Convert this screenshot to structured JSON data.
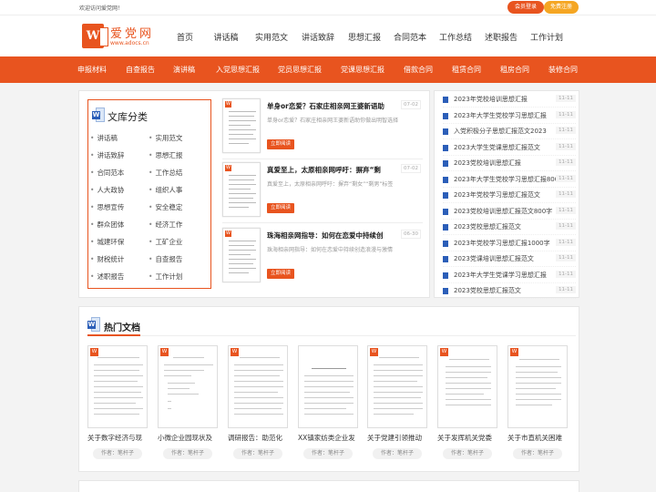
{
  "topbar": {
    "welcome": "欢迎访问爱党网！",
    "login": "会员登录",
    "register": "免费注册"
  },
  "logo": {
    "mark": "W",
    "name": "爱党网",
    "url": "www.adocs.cn"
  },
  "nav": [
    "首页",
    "讲话稿",
    "实用范文",
    "讲话致辞",
    "思想汇报",
    "合同范本",
    "工作总结",
    "述职报告",
    "工作计划"
  ],
  "subnav": [
    "申报材料",
    "自查报告",
    "演讲稿",
    "入党思想汇报",
    "党员思想汇报",
    "党课思想汇报",
    "借款合同",
    "租赁合同",
    "租房合同",
    "装修合同"
  ],
  "category": {
    "title": "文库分类",
    "items": [
      "讲话稿",
      "实用范文",
      "讲话致辞",
      "思想汇报",
      "合同范本",
      "工作总结",
      "人大政协",
      "组织人事",
      "思想宣传",
      "安全稳定",
      "群众团体",
      "经济工作",
      "城建环保",
      "工矿企业",
      "财税统计",
      "自查报告",
      "述职报告",
      "工作计划"
    ]
  },
  "articles": [
    {
      "title": "单身or恋爱？石家庄相亲网王婆新语助",
      "date": "07-02",
      "desc": "单身or恋爱？石家庄相亲网王婆新语助你做出明智选择",
      "button": "立即阅读"
    },
    {
      "title": "真爱至上，太原相亲网呼吁：摒弃“剩",
      "date": "07-02",
      "desc": "真爱至上，太原相亲网呼吁：摒弃“剩女”“剩男”标签",
      "button": "立即阅读"
    },
    {
      "title": "珠海相亲网指导：如何在恋爱中持续创",
      "date": "06-30",
      "desc": "珠海相亲网指导：如何在恋爱中持续创造浪漫与激情",
      "button": "立即阅读"
    }
  ],
  "right_list": [
    {
      "title": "2023年党校培训思想汇报",
      "date": "11-11"
    },
    {
      "title": "2023年大学生党校学习思想汇报",
      "date": "11-11"
    },
    {
      "title": "入党积极分子思想汇报范文2023",
      "date": "11-11"
    },
    {
      "title": "2023大学生党课思想汇报范文",
      "date": "11-11"
    },
    {
      "title": "2023党校培训思想汇报",
      "date": "11-11"
    },
    {
      "title": "2023年大学生党校学习思想汇报800",
      "date": "11-11"
    },
    {
      "title": "2023年党校学习思想汇报范文",
      "date": "11-11"
    },
    {
      "title": "2023党校培训思想汇报范文800字",
      "date": "11-11"
    },
    {
      "title": "2023党校思想汇报范文",
      "date": "11-11"
    },
    {
      "title": "2023年党校学习思想汇报1000字",
      "date": "11-11"
    },
    {
      "title": "2023党课培训思想汇报范文",
      "date": "11-11"
    },
    {
      "title": "2023年大学生党课学习思想汇报",
      "date": "11-11"
    },
    {
      "title": "2023党校思想汇报范文",
      "date": "11-11"
    }
  ],
  "hot": {
    "title": "热门文档",
    "docs": [
      {
        "name": "关于数字经济与现",
        "author": "作者：笔杆子"
      },
      {
        "name": "小微企业园现状及",
        "author": "作者：笔杆子"
      },
      {
        "name": "调研报告：助范化",
        "author": "作者：笔杆子"
      },
      {
        "name": "XX镇家纺类企业发",
        "author": "作者：笔杆子"
      },
      {
        "name": "关于党建引领推动",
        "author": "作者：笔杆子"
      },
      {
        "name": "关于发挥机关党委",
        "author": "作者：笔杆子"
      },
      {
        "name": "关于市直机关困难",
        "author": "作者：笔杆子"
      }
    ]
  },
  "colors": {
    "accent": "#e8541f",
    "secondary": "#f5a623",
    "word_blue": "#2b5eb8"
  },
  "icons": {
    "doc": "word-doc-icon"
  }
}
